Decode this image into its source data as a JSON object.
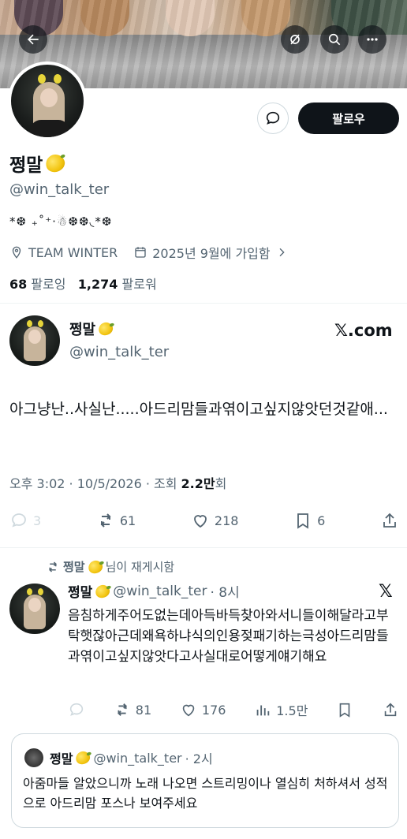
{
  "header": {
    "back_icon": "arrow-left-icon",
    "mute_icon": "eye-off-icon",
    "search_icon": "search-icon",
    "more_icon": "more-icon"
  },
  "profile": {
    "name": "쩡말",
    "handle": "@win_talk_ter",
    "bio": "*❆ ₊˚⁺‧☃❆❆◟*❆",
    "location": "TEAM WINTER",
    "joined": "2025년 9월에 가입함",
    "following_count": "68",
    "following_label": "팔로잉",
    "followers_count": "1,274",
    "followers_label": "팔로워",
    "follow_button": "팔로우"
  },
  "quoted_post": {
    "name": "쩡말",
    "handle": "@win_talk_ter",
    "source": "𝕏.com",
    "text": "아그냥난..사실난.....아드리맘들과엮이고싶지않앗던것같애...",
    "time_prefix": "오후 3:02 · 10/5/2026 · 조회",
    "views": "2.2만",
    "views_suffix": "회",
    "replies": "3",
    "reposts": "61",
    "likes": "218",
    "bookmarks": "6"
  },
  "repost_line": {
    "name": "쩡말",
    "suffix": "님이 재게시함"
  },
  "reply_post": {
    "name": "쩡말",
    "handle": "@win_talk_ter",
    "time": "· 8시",
    "text": "음침하게주어도없는데아득바득찾아와서니들이해달라고부탁햇잖아근데왜욕하냐식의인용젖패기하는극성아드리맘들과엮이고싶지않앗다고사실대로어떻게얘기해요",
    "reposts": "81",
    "likes": "176",
    "views": "1.5만"
  },
  "quote_card": {
    "name": "쩡말",
    "handle": "@win_talk_ter",
    "time": "· 2시",
    "text": "아줌마들 알았으니까 노래 나오면 스트리밍이나 열심히 처하셔서 성적으로 아드리맘 포스나 보여주세요"
  }
}
